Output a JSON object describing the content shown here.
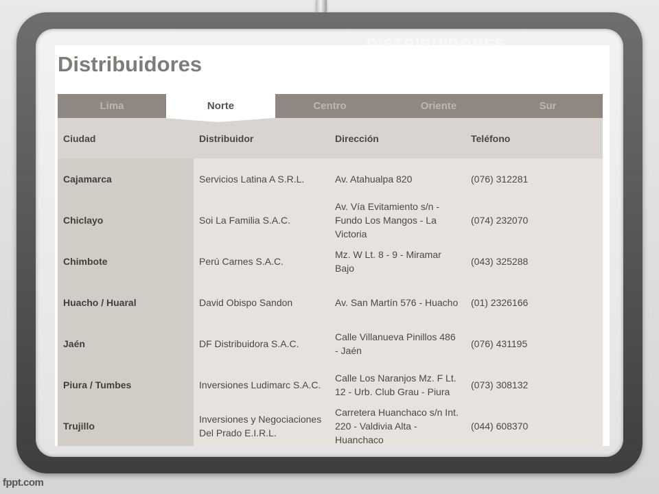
{
  "watermark": "DISTRIBUIDORES",
  "page": {
    "title": "Distribuidores"
  },
  "tabs": [
    {
      "label": "Lima",
      "active": false
    },
    {
      "label": "Norte",
      "active": true
    },
    {
      "label": "Centro",
      "active": false
    },
    {
      "label": "Oriente",
      "active": false
    },
    {
      "label": "Sur",
      "active": false
    }
  ],
  "table": {
    "headers": [
      "Ciudad",
      "Distribuidor",
      "Dirección",
      "Teléfono"
    ],
    "rows": [
      {
        "ciudad": "Cajamarca",
        "distribuidor": "Servicios Latina A S.R.L.",
        "direccion": "Av. Atahualpa 820",
        "telefono": "(076) 312281"
      },
      {
        "ciudad": "Chiclayo",
        "distribuidor": "Soi La Familia S.A.C.",
        "direccion": "Av. Vía Evitamiento s/n - Fundo Los Mangos - La Victoria",
        "telefono": "(074) 232070"
      },
      {
        "ciudad": "Chimbote",
        "distribuidor": "Perú Carnes S.A.C.",
        "direccion": "Mz. W Lt. 8 - 9 - Miramar Bajo",
        "telefono": "(043) 325288"
      },
      {
        "ciudad": "Huacho / Huaral",
        "distribuidor": "David Obispo Sandon",
        "direccion": "Av. San Martín 576 - Huacho",
        "telefono": "(01) 2326166"
      },
      {
        "ciudad": "Jaén",
        "distribuidor": "DF Distribuidora S.A.C.",
        "direccion": "Calle Villanueva Pinillos 486  - Jaén",
        "telefono": "(076) 431195"
      },
      {
        "ciudad": "Piura / Tumbes",
        "distribuidor": "Inversiones Ludimarc S.A.C.",
        "direccion": "Calle Los Naranjos Mz. F Lt. 12 - Urb. Club Grau - Piura",
        "telefono": "(073) 308132"
      },
      {
        "ciudad": "Trujillo",
        "distribuidor": "Inversiones y Negociaciones Del Prado E.I.R.L.",
        "direccion": "Carretera Huanchaco s/n Int. 220 - Valdivia Alta - Huanchaco",
        "telefono": "(044) 608370"
      }
    ]
  },
  "footer": {
    "brand": "fppt.com"
  },
  "colors": {
    "tab_bar": "#8f8781",
    "tab_text": "#beb7b1",
    "title": "#7f7b77",
    "city_column": "#d2ccc6",
    "table_bg": "#e6e3df"
  }
}
